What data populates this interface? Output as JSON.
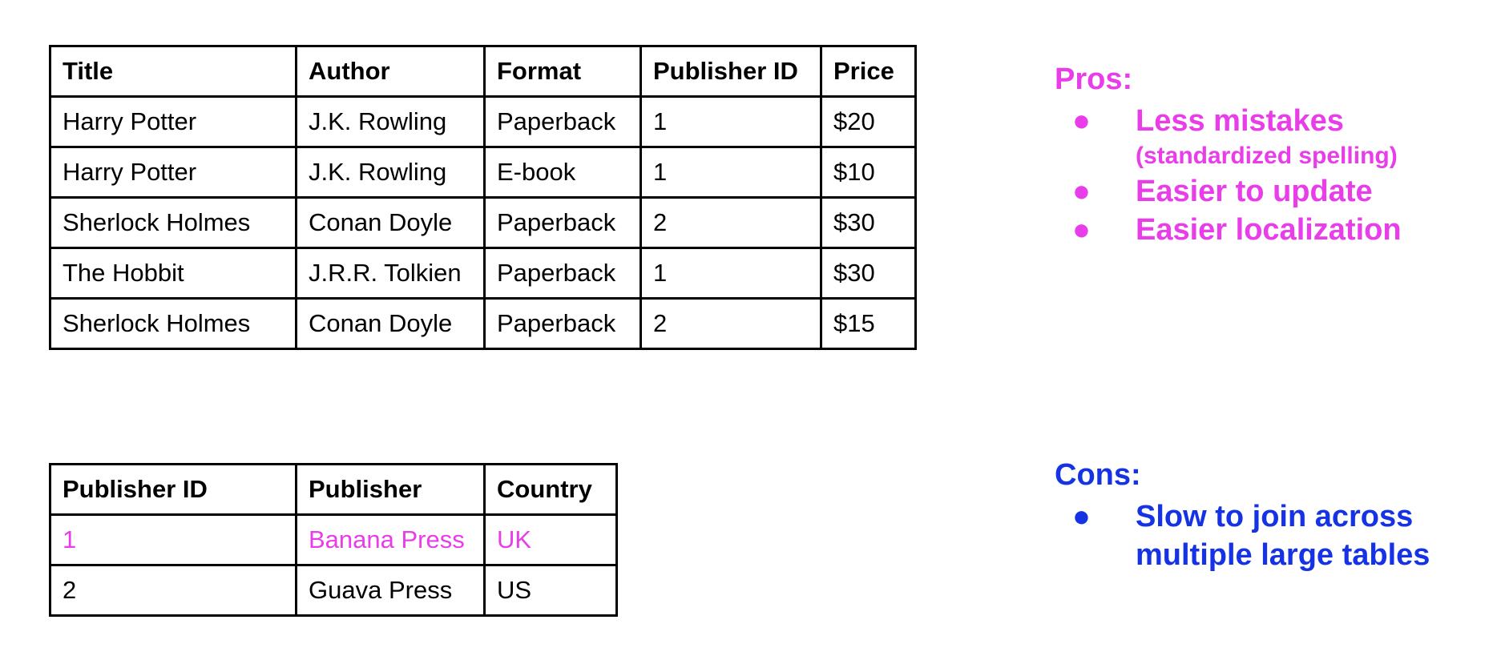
{
  "colors": {
    "pink": "#e83de8",
    "blue": "#1533e4",
    "text": "#000000"
  },
  "books_table": {
    "headers": [
      "Title",
      "Author",
      "Format",
      "Publisher ID",
      "Price"
    ],
    "rows": [
      [
        "Harry Potter",
        "J.K. Rowling",
        "Paperback",
        "1",
        "$20"
      ],
      [
        "Harry Potter",
        "J.K. Rowling",
        "E-book",
        "1",
        "$10"
      ],
      [
        "Sherlock Holmes",
        "Conan Doyle",
        "Paperback",
        "2",
        "$30"
      ],
      [
        "The Hobbit",
        "J.R.R. Tolkien",
        "Paperback",
        "1",
        "$30"
      ],
      [
        "Sherlock Holmes",
        "Conan Doyle",
        "Paperback",
        "2",
        "$15"
      ]
    ]
  },
  "publishers_table": {
    "headers": [
      "Publisher ID",
      "Publisher",
      "Country"
    ],
    "rows": [
      [
        "1",
        "Banana Press",
        "UK"
      ],
      [
        "2",
        "Guava Press",
        "US"
      ]
    ],
    "highlighted_row": 0
  },
  "pros": {
    "title": "Pros:",
    "items": [
      {
        "text": "Less mistakes",
        "note": "(standardized spelling)"
      },
      {
        "text": "Easier to update"
      },
      {
        "text": "Easier localization"
      }
    ]
  },
  "cons": {
    "title": "Cons:",
    "items": [
      {
        "text": "Slow to join across",
        "text2": "multiple large tables"
      }
    ]
  },
  "bullet_glyph": "●"
}
